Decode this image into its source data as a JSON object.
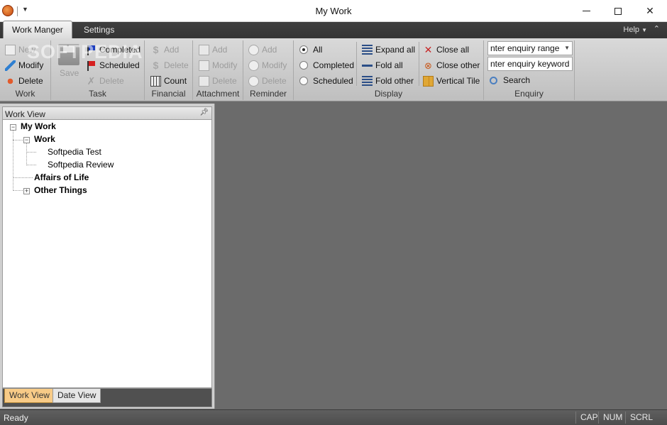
{
  "window": {
    "title": "My Work"
  },
  "tabs": {
    "work_manager": "Work Manger",
    "settings": "Settings",
    "help": "Help"
  },
  "ribbon": {
    "work": {
      "label": "Work",
      "new": "New",
      "modify": "Modify",
      "delete": "Delete"
    },
    "task": {
      "label": "Task",
      "save": "Save",
      "completed": "Completed",
      "scheduled": "Scheduled",
      "delete": "Delete"
    },
    "financial": {
      "label": "Financial",
      "add": "Add",
      "delete": "Delete",
      "count": "Count"
    },
    "attachment": {
      "label": "Attachment",
      "add": "Add",
      "modify": "Modify",
      "delete": "Delete"
    },
    "reminder": {
      "label": "Reminder",
      "add": "Add",
      "modify": "Modify",
      "delete": "Delete"
    },
    "display": {
      "label": "Display",
      "all": "All",
      "completed": "Completed",
      "scheduled": "Scheduled",
      "selected": "All",
      "expand_all": "Expand all",
      "fold_all": "Fold all",
      "fold_other": "Fold other",
      "close_all": "Close all",
      "close_other": "Close other",
      "vertical_tile": "Vertical Tile"
    },
    "enquiry": {
      "label": "Enquiry",
      "range": "nter enquiry range",
      "keyword": "nter enquiry keyword",
      "search": "Search"
    }
  },
  "watermark": "SOFTPEDIA",
  "work_view": {
    "title": "Work View",
    "tree": {
      "root": "My Work",
      "work": "Work",
      "work_children": [
        "Softpedia Test",
        "Softpedia Review"
      ],
      "affairs": "Affairs of Life",
      "other": "Other Things"
    },
    "bottom_tabs": [
      "Work View",
      "Date View"
    ]
  },
  "status": {
    "text": "Ready",
    "indicators": [
      "CAP",
      "NUM",
      "SCRL"
    ]
  }
}
